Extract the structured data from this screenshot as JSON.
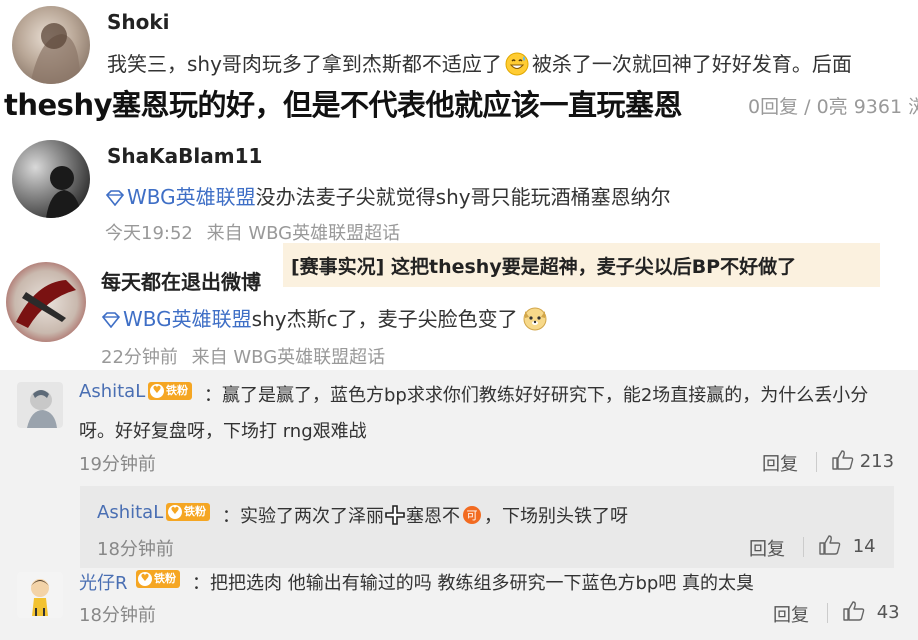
{
  "weibo_comments": [
    {
      "username": "Shoki",
      "text": "我笑三，shy哥肉玩多了拿到杰斯都不适应了",
      "text_after_emoji": "被杀了一次就回神了好好发育。后面"
    },
    {
      "username": "ShaKaBlam11",
      "topic": "WBG英雄联盟",
      "text": "没办法麦子尖就觉得shy哥只能玩酒桶塞恩纳尔",
      "time": "今天19:52",
      "source": "来自 WBG英雄联盟超话"
    },
    {
      "username": "每天都在退出微博",
      "topic": "WBG英雄联盟",
      "text": "shy杰斯c了，麦子尖脸色变了",
      "time": "22分钟前",
      "source": "来自 WBG英雄联盟超话"
    }
  ],
  "overlay": {
    "title": "theshy塞恩玩的好，但是不代表他就应该一直玩塞恩",
    "stats": "0回复 / 0亮 9361 浏"
  },
  "highlight": {
    "text": "[赛事实况] 这把theshy要是超神，麦子尖以后BP不好做了"
  },
  "panel_comments": [
    {
      "username": "AshitaL",
      "badge": "铁粉",
      "text_line1": "：赢了是赢了，蓝色方bp求求你们教练好好研究下，能2场直接赢的，为什么丢小分",
      "text_line2": "呀。好好复盘呀，下场打 rng艰难战",
      "time": "19分钟前",
      "reply": "回复",
      "likes": "213"
    },
    {
      "username": "AshitaL",
      "badge": "铁粉",
      "text_before": "：实验了两次了泽丽",
      "text_mid": "塞恩不",
      "text_after": "，下场别头铁了呀",
      "time": "18分钟前",
      "reply": "回复",
      "likes": "14"
    },
    {
      "username": "光仔R",
      "badge": "铁粉",
      "text": "：把把选肉 他输出有输过的吗 教练组多研究一下蓝色方bp吧 真的太臭",
      "time": "18分钟前",
      "reply": "回复",
      "likes": "43"
    }
  ],
  "colors": {
    "topic_blue": "#3f6fc6",
    "name_blue": "#4a6fb3",
    "badge_orange": "#f5a623",
    "highlight_bg": "#fbf1df",
    "panel_bg": "#f2f2f2"
  },
  "icons": [
    "diamond-icon",
    "thumbs-up-icon",
    "grinning-sweat-emoji-icon",
    "dog-face-emoji-icon",
    "cross-icon",
    "orange-circle-emoji-icon"
  ]
}
